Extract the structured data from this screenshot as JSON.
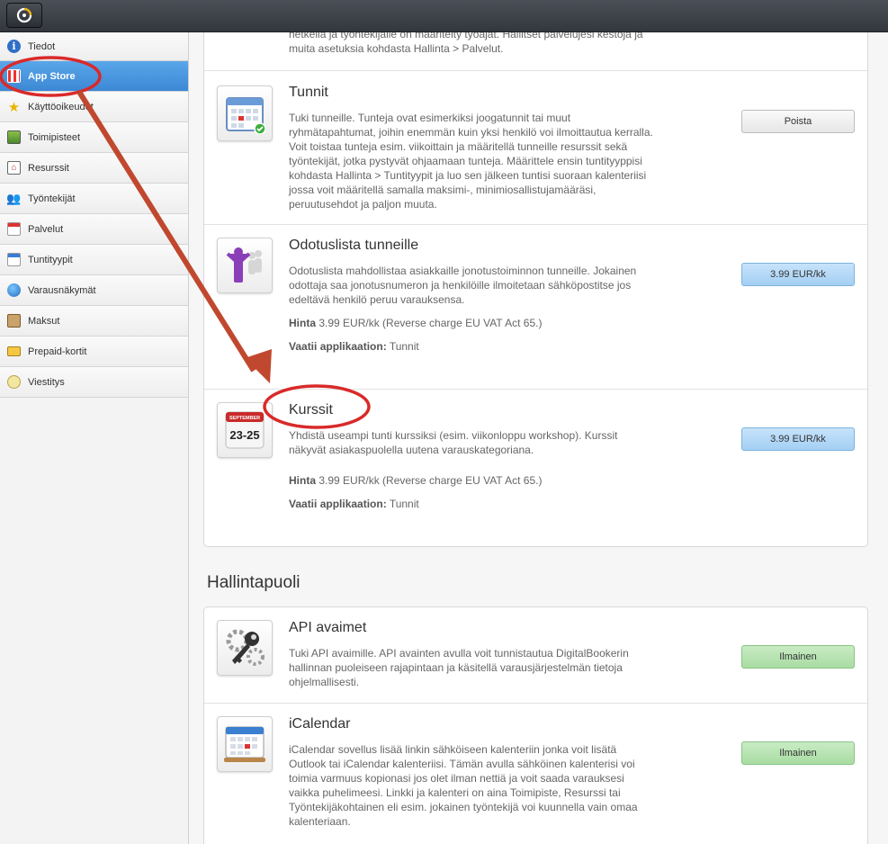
{
  "topbar": {
    "logo_icon": "brand-logo-icon"
  },
  "sidebar": {
    "items": [
      {
        "label": "Tiedot",
        "icon": "info-icon"
      },
      {
        "label": "App Store",
        "icon": "store-icon",
        "active": true
      },
      {
        "label": "Käyttöoikeudet",
        "icon": "star-icon"
      },
      {
        "label": "Toimipisteet",
        "icon": "location-icon"
      },
      {
        "label": "Resurssit",
        "icon": "house-icon"
      },
      {
        "label": "Työntekijät",
        "icon": "people-icon"
      },
      {
        "label": "Palvelut",
        "icon": "calendar-icon"
      },
      {
        "label": "Tuntityypit",
        "icon": "calendar-icon"
      },
      {
        "label": "Varausnäkymät",
        "icon": "globe-icon"
      },
      {
        "label": "Maksut",
        "icon": "cash-icon"
      },
      {
        "label": "Prepaid-kortit",
        "icon": "card-icon"
      },
      {
        "label": "Viestitys",
        "icon": "chat-icon"
      }
    ]
  },
  "apps_top": {
    "partial_text": "hetkellä ja työntekijälle on määritelty työajat. Hallitset palvelujesi kestoja ja muita asetuksia kohdasta Hallinta > Palvelut.",
    "rows": [
      {
        "title": "Tunnit",
        "description": "Tuki tunneille. Tunteja ovat esimerkiksi joogatunnit tai muut ryhmätapahtumat, joihin enemmän kuin yksi henkilö voi ilmoittautua kerralla. Voit toistaa tunteja esim. viikoittain ja määritellä tunneille resurssit sekä työntekijät, jotka pystyvät ohjaamaan tunteja. Määrittele ensin tuntityyppisi kohdasta Hallinta > Tuntityypit ja luo sen jälkeen tuntisi suoraan kalenteriisi jossa voit määritellä samalla maksimi-, minimiosallistujamääräsi, peruutusehdot ja paljon muuta.",
        "button": "Poista"
      },
      {
        "title": "Odotuslista tunneille",
        "description": "Odotuslista mahdollistaa asiakkaille jonotustoiminnon tunneille. Jokainen odottaja saa jonotusnumeron ja henkilöille ilmoitetaan sähköpostitse jos edeltävä henkilö peruu varauksensa.",
        "price_label": "Hinta",
        "price_value": "3.99 EUR/kk (Reverse charge EU VAT Act 65.)",
        "requires_label": "Vaatii applikaation:",
        "requires_value": "Tunnit",
        "button": "3.99 EUR/kk"
      },
      {
        "title": "Kurssit",
        "description": "Yhdistä useampi tunti kurssiksi (esim. viikonloppu workshop). Kurssit näkyvät asiakaspuolella uutena varauskategoriana.",
        "price_label": "Hinta",
        "price_value": "3.99 EUR/kk (Reverse charge EU VAT Act 65.)",
        "requires_label": "Vaatii applikaation:",
        "requires_value": "Tunnit",
        "button": "3.99 EUR/kk",
        "icon_month": "SEPTEMBER",
        "icon_dates": "23-25"
      }
    ]
  },
  "section": {
    "title": "Hallintapuoli"
  },
  "apps_admin": {
    "rows": [
      {
        "title": "API avaimet",
        "description": "Tuki API avaimille. API avainten avulla voit tunnistautua DigitalBookerin hallinnan puoleiseen rajapintaan ja käsitellä varausjärjestelmän tietoja ohjelmallisesti.",
        "button": "Ilmainen"
      },
      {
        "title": "iCalendar",
        "description": "iCalendar sovellus lisää linkin sähköiseen kalenteriin jonka voit lisätä Outlook tai iCalendar kalenteriisi. Tämän avulla sähköinen kalenterisi voi toimia varmuus kopionasi jos olet ilman nettiä ja voit saada varauksesi vaikka puhelimeesi. Linkki ja kalenteri on aina Toimipiste, Resurssi tai Työntekijäkohtainen eli esim. jokainen työntekijä voi kuunnella vain omaa kalenteriaan.",
        "button": "Ilmainen"
      }
    ]
  },
  "colors": {
    "accent": "#3c88d4",
    "annotation": "#d92a2a",
    "arrow": "#c0482f"
  }
}
